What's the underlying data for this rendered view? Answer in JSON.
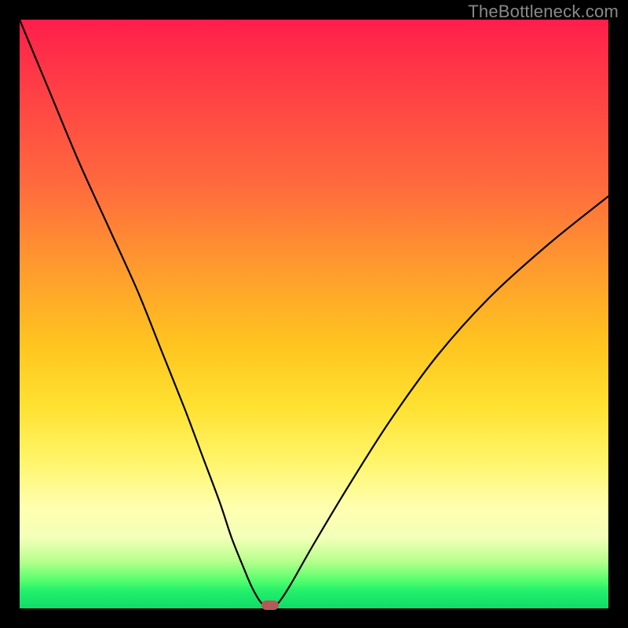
{
  "watermark": "TheBottleneck.com",
  "chart_data": {
    "type": "line",
    "title": "",
    "xlabel": "",
    "ylabel": "",
    "xlim": [
      0,
      100
    ],
    "ylim": [
      0,
      100
    ],
    "grid": false,
    "legend": false,
    "series": [
      {
        "name": "bottleneck-curve",
        "x": [
          0,
          5,
          10,
          15,
          20,
          24,
          28,
          31,
          34,
          36,
          38,
          39.5,
          41,
          42.5,
          44,
          46,
          50,
          56,
          63,
          71,
          80,
          90,
          100
        ],
        "y": [
          100,
          88,
          76,
          65,
          54,
          44,
          34,
          26,
          18,
          12,
          7,
          3.5,
          1,
          0,
          1,
          4,
          11,
          21,
          32,
          43,
          53,
          62,
          70
        ]
      }
    ],
    "marker": {
      "x": 42.5,
      "y": 0,
      "color": "#b55a56"
    },
    "background_gradient": {
      "top": "#ff1e4b",
      "mid_upper": "#ff9a2e",
      "mid": "#fff56a",
      "mid_lower": "#b7ff8d",
      "bottom": "#0fdc68"
    }
  }
}
